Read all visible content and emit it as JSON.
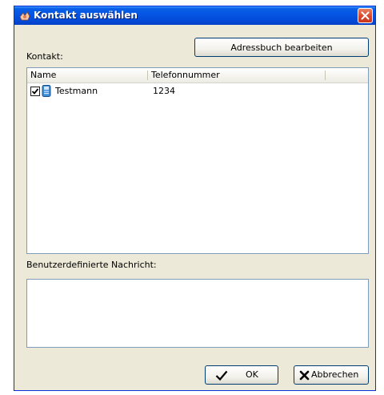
{
  "window": {
    "title": "Kontakt auswählen"
  },
  "form": {
    "contact_label": "Kontakt:",
    "edit_addressbook_button": "Adressbuch bearbeiten",
    "message_label": "Benutzerdefinierte Nachricht:",
    "message_value": ""
  },
  "list": {
    "columns": [
      "Name",
      "Telefonnummer"
    ],
    "rows": [
      {
        "checked": true,
        "name": "Testmann",
        "phone": "1234"
      }
    ]
  },
  "buttons": {
    "ok": "OK",
    "cancel": "Abbrechen"
  },
  "colors": {
    "title_bar": "#0554e3",
    "window_bg": "#ece9d8",
    "close_button": "#d6452a"
  }
}
